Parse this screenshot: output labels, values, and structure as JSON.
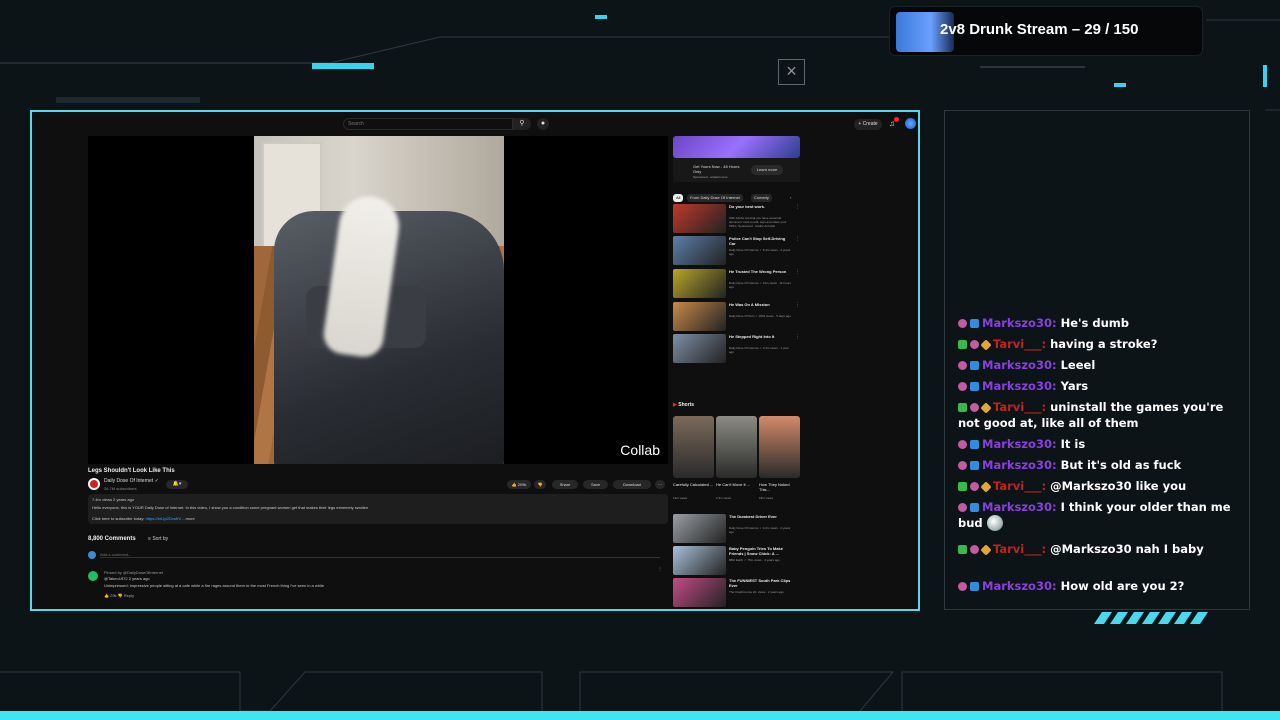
{
  "stream": {
    "title": "2v8 Drunk Stream – 29 / 150",
    "close_glyph": "×"
  },
  "youtube": {
    "search_placeholder": "Search",
    "create_label": "+ Create",
    "video": {
      "title": "Legs Shouldn't Look Like This",
      "overlay_label": "Collab"
    },
    "channel": {
      "name": "Daily Dose Of Internet ✓",
      "subscribers": "26.7M subscribers"
    },
    "actions": {
      "like": "209k",
      "share": "Share",
      "save": "Save",
      "download": "Download"
    },
    "description": {
      "stats": "7.4m views  2 years ago",
      "text": "Hello everyone, this is YOUR Daily Dose of Internet. In this video, I show you a condition some pregnant women get that makes their legs extremely swollen",
      "subscribe_prefix": "Click here to subscribe today:",
      "subscribe_link": "https://bit.ly/2DzsfrV",
      "more": "...more"
    },
    "comments": {
      "count": "8,800 Comments",
      "sort": "Sort by",
      "add_placeholder": "Add a comment...",
      "pinned": "Pinned by @DailyDoseOfInternet",
      "author": "@Takeo1972  2 years ago",
      "text": "Unimpressed: impressive people sitting at a cafe while a fire rages around them to the most French thing I've seen in a while",
      "likes": "29k",
      "reply": "Reply"
    },
    "ad": {
      "text": "Get Yours Now - 48 Hours Only",
      "sponsored": "Sponsored · amazon.com",
      "learn_more": "Learn more"
    },
    "chips": [
      "All",
      "From Daily Dose Of Internet",
      "Comedy"
    ],
    "recommendations": [
      {
        "title": "Do your best work.",
        "meta": "With Adobe Acrobat you have essential document tools to edit, sign and share your PDFs. Sponsored · Adobe Acrobat",
        "color": "#c0392b"
      },
      {
        "title": "Police Can't Stop Self-Driving Car",
        "meta": "Daily Dose Of Internet ✓ 5.4m views · 2 years ago",
        "color": "#5d7fa8"
      },
      {
        "title": "He Trusted The Wrong Person",
        "meta": "Daily Dose Of Internet ✓ 14m views · 11 hours ago",
        "color": "#b8a628"
      },
      {
        "title": "He Was On A Mission",
        "meta": "Daily Dose Of Petn ✓ 260k views · 5 days ago",
        "color": "#c98a4a"
      },
      {
        "title": "He Stepped Right Into It",
        "meta": "Daily Dose Of Internet ✓ 3.4m views · 1 year ago",
        "color": "#7f8fa6"
      }
    ],
    "shorts_label": "Shorts",
    "shorts": [
      {
        "title": "Carefully Calculated ...",
        "views": "12m views",
        "color": "#7b6a5a"
      },
      {
        "title": "He Can't Move It ...",
        "views": "2.3m views",
        "color": "#8c8c84"
      },
      {
        "title": "How They Nuked This...",
        "views": "18m views",
        "color": "#d38a6a"
      }
    ],
    "recommendations_lower": [
      {
        "title": "The Dumbest Driver Ever",
        "meta": "Daily Dose Of Internet ✓ 3.2m views · 2 years ago",
        "color": "#9aa0a6"
      },
      {
        "title": "Baby Penguin Tries To Make Friends | Snow Chick: A ...",
        "meta": "BBC Earth ✓ 75m views · 4 years ago",
        "color": "#a9c2d8"
      },
      {
        "title": "The FUNNIEST South Park Clips Ever",
        "meta": "The Crashcourse 2m views · 2 years ago",
        "color": "#c44c88"
      }
    ]
  },
  "chat": [
    {
      "badges": [
        "pink",
        "blue"
      ],
      "user": "Markszo30:",
      "type": "m",
      "message": "He's dumb"
    },
    {
      "badges": [
        "green",
        "pink",
        "gold"
      ],
      "user": "Tarvi___:",
      "type": "t",
      "message": "having a stroke?"
    },
    {
      "badges": [
        "pink",
        "blue"
      ],
      "user": "Markszo30:",
      "type": "m",
      "message": "Leeel"
    },
    {
      "badges": [
        "pink",
        "blue"
      ],
      "user": "Markszo30:",
      "type": "m",
      "message": "Yars"
    },
    {
      "badges": [
        "green",
        "pink",
        "gold"
      ],
      "user": "Tarvi___:",
      "type": "t",
      "message": "uninstall the games you're not good at, like all of them"
    },
    {
      "badges": [
        "pink",
        "blue"
      ],
      "user": "Markszo30:",
      "type": "m",
      "message": "It is"
    },
    {
      "badges": [
        "pink",
        "blue"
      ],
      "user": "Markszo30:",
      "type": "m",
      "message": "But it's old as fuck"
    },
    {
      "badges": [
        "green",
        "pink",
        "gold"
      ],
      "user": "Tarvi___:",
      "type": "t",
      "message": "@Markszo30 like you"
    },
    {
      "badges": [
        "pink",
        "blue"
      ],
      "user": "Markszo30:",
      "type": "m",
      "message": "I think your older than me bud"
    },
    {
      "badges": [
        "green",
        "pink",
        "gold"
      ],
      "user": "Tarvi___:",
      "type": "t",
      "message": "@Markszo30 nah I baby"
    },
    {
      "badges": [
        "pink",
        "blue"
      ],
      "user": "Markszo30:",
      "type": "m",
      "message": "How old are you 2?"
    }
  ]
}
